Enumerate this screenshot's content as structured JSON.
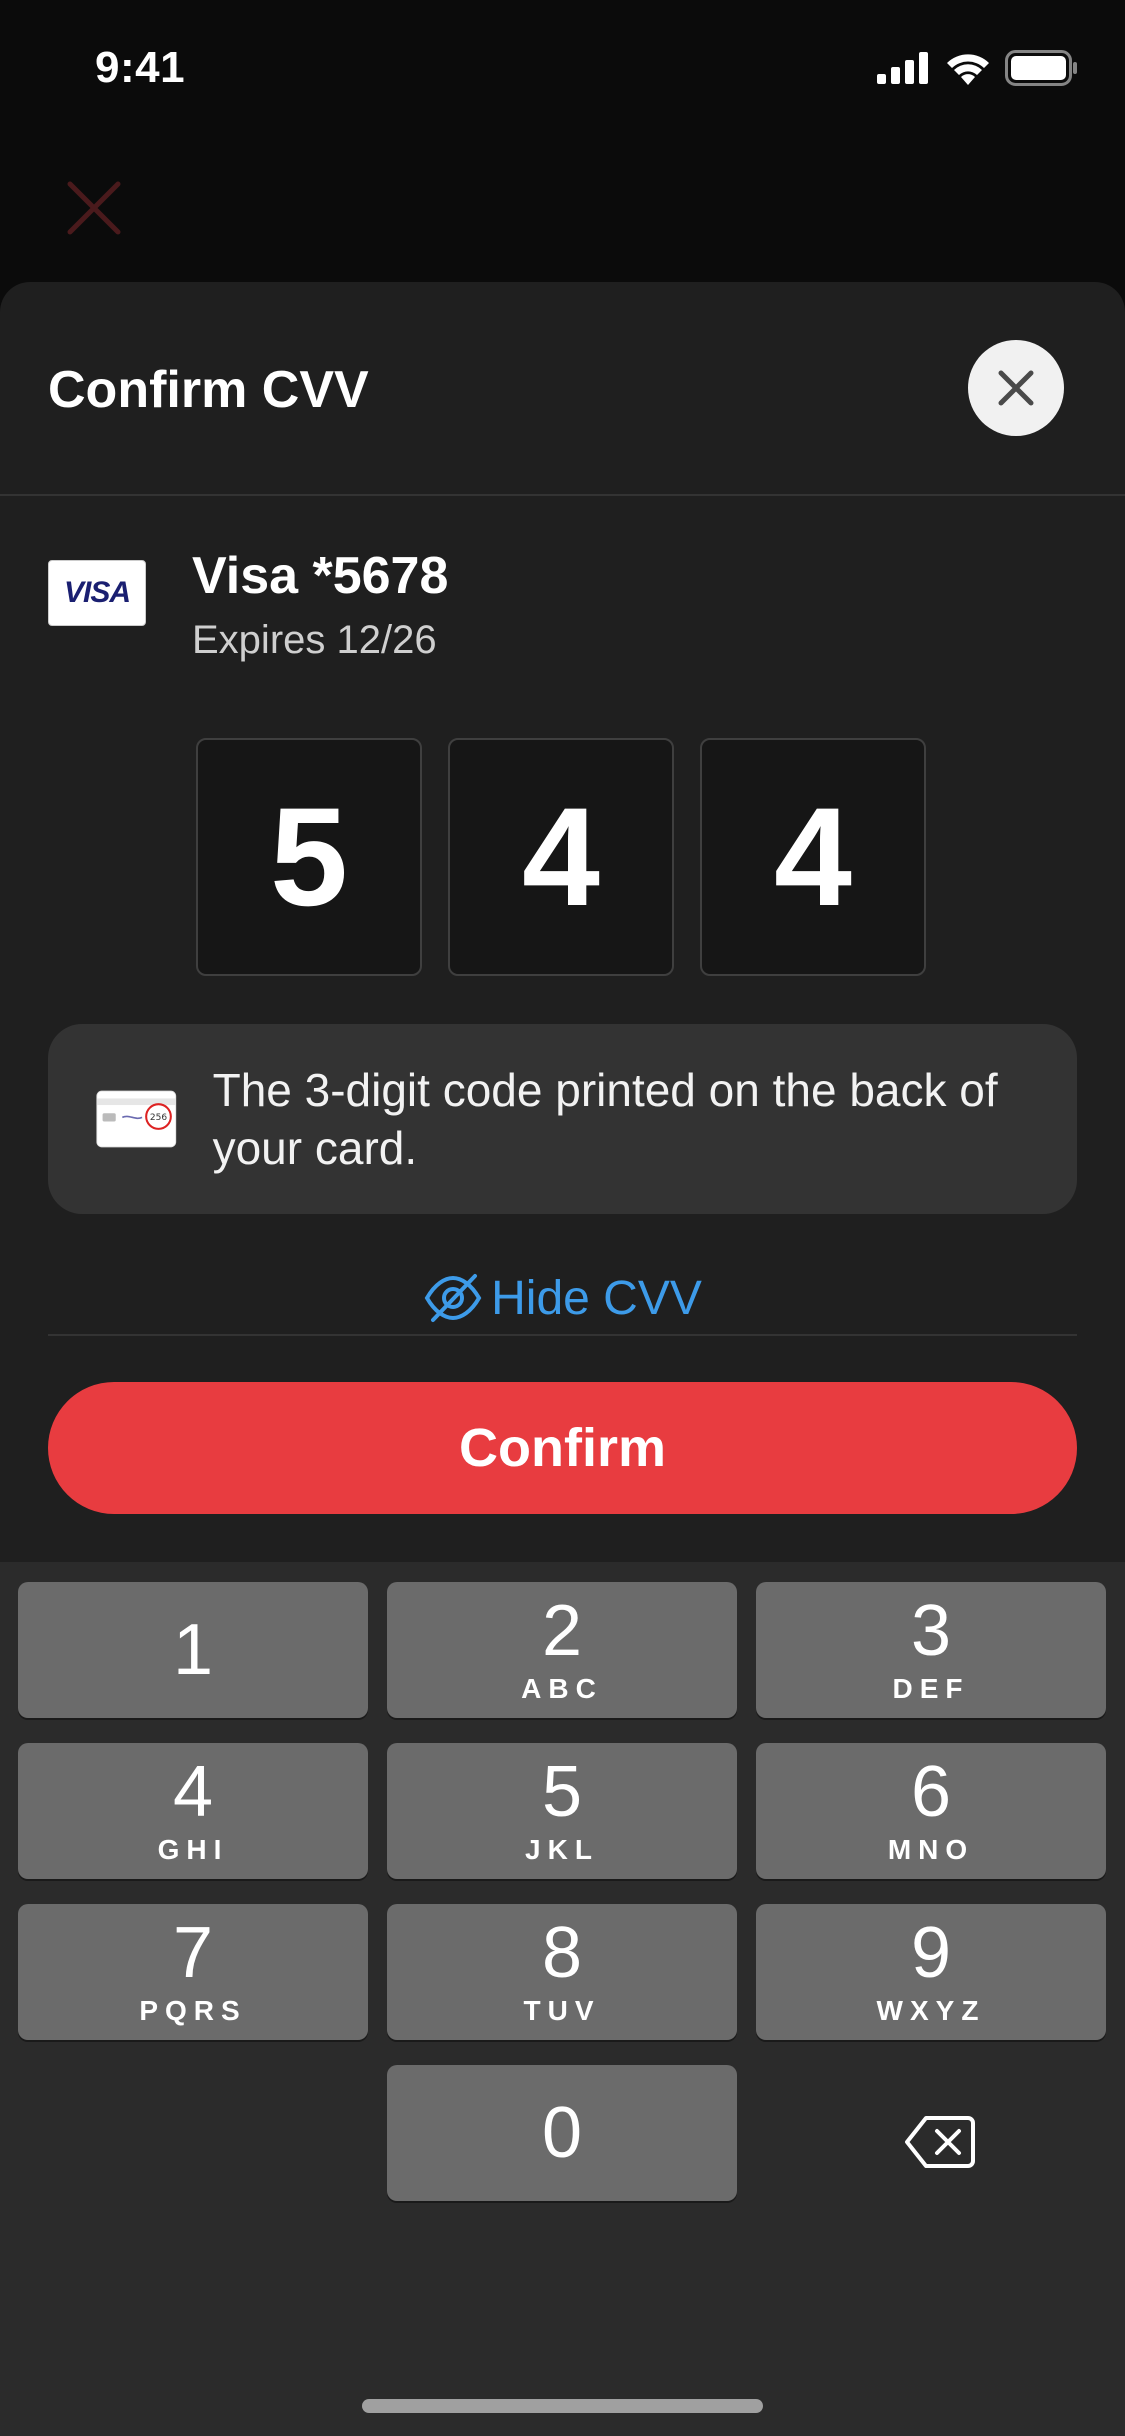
{
  "status": {
    "time": "9:41"
  },
  "sheet": {
    "title": "Confirm CVV"
  },
  "card": {
    "brand": "VISA",
    "name": "Visa *5678",
    "expiry": "Expires 12/26"
  },
  "cvv": {
    "digits": [
      "5",
      "4",
      "4"
    ]
  },
  "hint": {
    "text": "The 3-digit code printed on the back of your card.",
    "card_code": "256"
  },
  "toggle": {
    "label": "Hide CVV"
  },
  "confirm": {
    "label": "Confirm"
  },
  "keypad": {
    "keys": [
      {
        "num": "1",
        "letters": ""
      },
      {
        "num": "2",
        "letters": "ABC"
      },
      {
        "num": "3",
        "letters": "DEF"
      },
      {
        "num": "4",
        "letters": "GHI"
      },
      {
        "num": "5",
        "letters": "JKL"
      },
      {
        "num": "6",
        "letters": "MNO"
      },
      {
        "num": "7",
        "letters": "PQRS"
      },
      {
        "num": "8",
        "letters": "TUV"
      },
      {
        "num": "9",
        "letters": "WXYZ"
      },
      {
        "num": "0",
        "letters": ""
      }
    ]
  },
  "colors": {
    "accent": "#e83c40",
    "link": "#3d9be9",
    "sheet_bg": "#1f1f1f",
    "key_bg": "#6b6b6b"
  }
}
